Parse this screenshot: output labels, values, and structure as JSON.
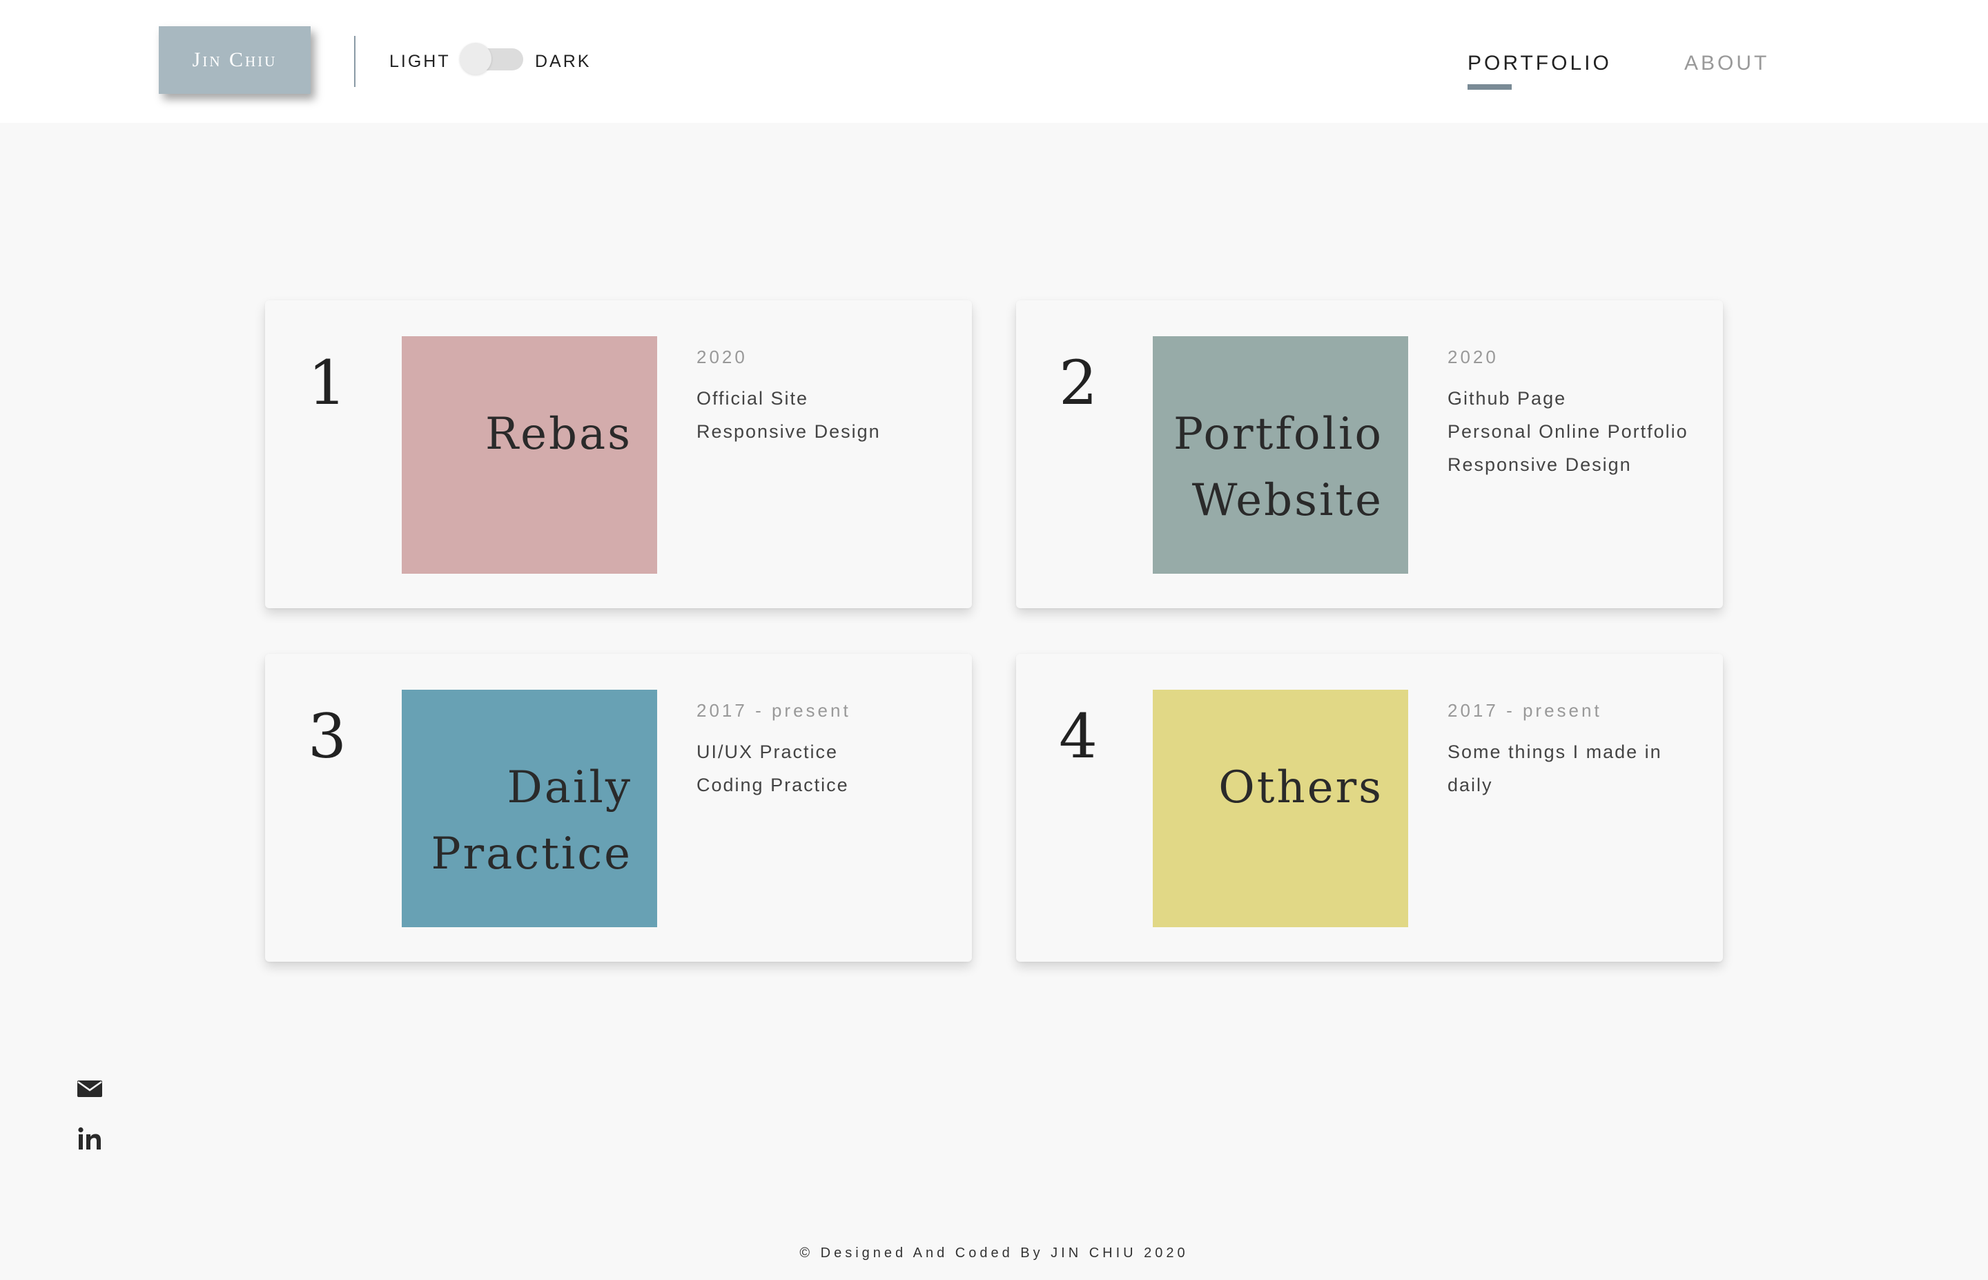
{
  "header": {
    "logo_text": "Jin Chiu",
    "theme_light_label": "LIGHT",
    "theme_dark_label": "DARK",
    "nav": {
      "portfolio_label": "PORTFOLIO",
      "about_label": "ABOUT",
      "active": "PORTFOLIO"
    }
  },
  "cards": [
    {
      "number": "1",
      "title_lines": [
        "Rebas"
      ],
      "color": "#d3acac",
      "year": "2020",
      "lines": [
        "Official Site",
        "Responsive Design"
      ]
    },
    {
      "number": "2",
      "title_lines": [
        "Portfolio",
        "Website"
      ],
      "color": "#97aba8",
      "year": "2020",
      "lines": [
        "Github Page",
        "Personal Online Portfolio",
        "Responsive Design"
      ]
    },
    {
      "number": "3",
      "title_lines": [
        "Daily",
        "Practice"
      ],
      "color": "#68a1b4",
      "year": "2017 - present",
      "lines": [
        "UI/UX Practice",
        "Coding Practice"
      ]
    },
    {
      "number": "4",
      "title_lines": [
        "Others"
      ],
      "color": "#e1d886",
      "year": "2017 - present",
      "lines": [
        "Some things I made in",
        "daily"
      ]
    }
  ],
  "social": {
    "icons": [
      "mail-icon",
      "linkedin-icon"
    ]
  },
  "footer": {
    "text": "© Designed And Coded By JIN CHIU 2020"
  },
  "colors": {
    "logo_bg": "#a8b8c0",
    "nav_underline": "#7a8b96",
    "page_bg": "#f8f8f8",
    "header_bg": "#ffffff"
  }
}
